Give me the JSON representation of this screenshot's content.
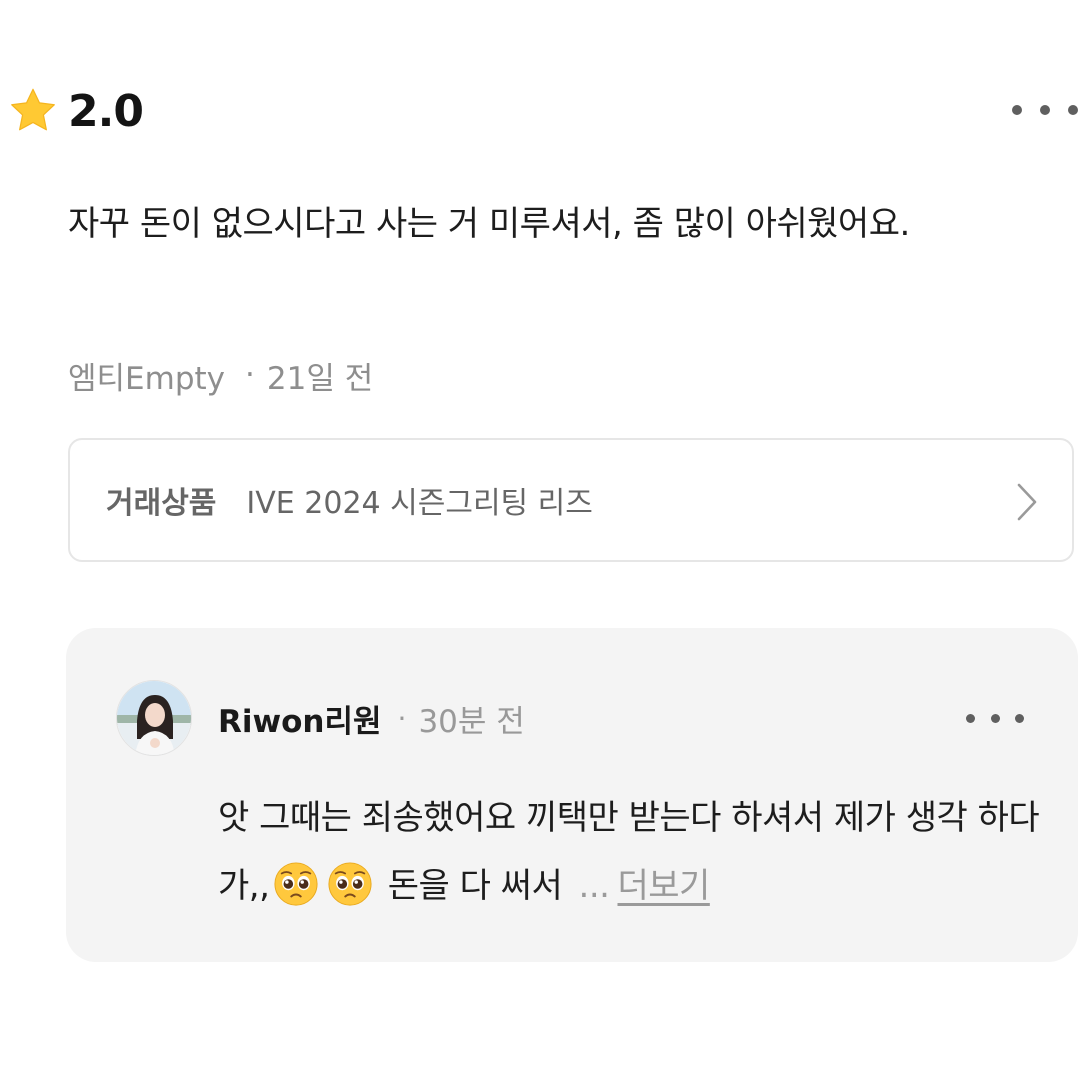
{
  "review": {
    "rating": "2.0",
    "text": "자꾸 돈이 없으시다고 사는 거 미루셔서, 좀 많이 아쉬웠어요.",
    "author": "엠티Empty",
    "separator": "·",
    "time": "21일 전"
  },
  "product": {
    "label": "거래상품",
    "name": "IVE 2024 시즌그리팅 리즈"
  },
  "reply": {
    "author": "Riwon리원",
    "separator": "·",
    "time": "30분 전",
    "text_before": "앗 그때는 죄송했어요 끼택만 받는다 하셔서 제가 생각 하다가,,",
    "emojis": [
      "pleading-face",
      "pleading-face"
    ],
    "text_after": "돈을 다 써서",
    "ellipsis": "...",
    "more_label": "더보기"
  },
  "icons": {
    "star": "star-icon",
    "more": "more-dots-icon",
    "chevron": "chevron-right-icon"
  },
  "colors": {
    "star": "#FFC933",
    "reply_background": "#F4F4F4",
    "muted_text": "#8E8E8E"
  }
}
